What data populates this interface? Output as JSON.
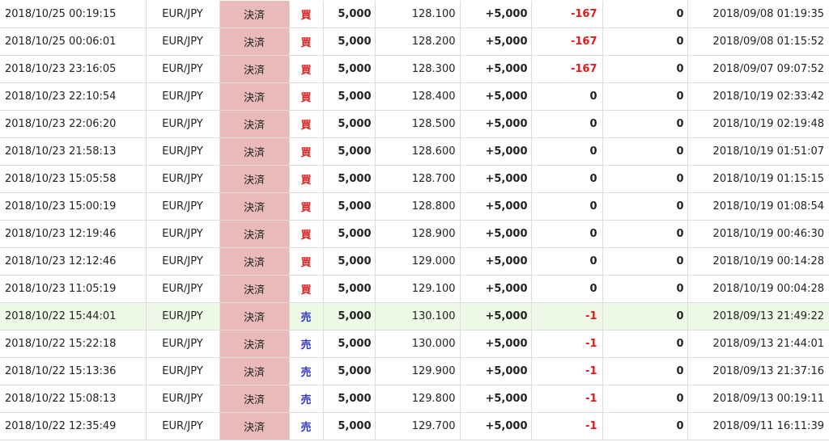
{
  "colors": {
    "buy": "#dd2020",
    "sell": "#2f35c8",
    "swap_positive": "#1a9a1a",
    "pl_negative": "#e01a1a",
    "type_bg": "#eab9b9",
    "highlight_row": "#eef9e7"
  },
  "rows": [
    {
      "time": "2018/10/25 00:19:15",
      "pair": "EUR/JPY",
      "type": "決済",
      "side": "買",
      "side_kind": "buy",
      "qty": "5,000",
      "rate": "128.100",
      "swap": "+5,000",
      "pl": "-167",
      "pl_kind": "neg",
      "fee": "0",
      "open_time": "2018/09/08 01:19:35",
      "highlight": false
    },
    {
      "time": "2018/10/25 00:06:01",
      "pair": "EUR/JPY",
      "type": "決済",
      "side": "買",
      "side_kind": "buy",
      "qty": "5,000",
      "rate": "128.200",
      "swap": "+5,000",
      "pl": "-167",
      "pl_kind": "neg",
      "fee": "0",
      "open_time": "2018/09/08 01:15:52",
      "highlight": false
    },
    {
      "time": "2018/10/23 23:16:05",
      "pair": "EUR/JPY",
      "type": "決済",
      "side": "買",
      "side_kind": "buy",
      "qty": "5,000",
      "rate": "128.300",
      "swap": "+5,000",
      "pl": "-167",
      "pl_kind": "neg",
      "fee": "0",
      "open_time": "2018/09/07 09:07:52",
      "highlight": false
    },
    {
      "time": "2018/10/23 22:10:54",
      "pair": "EUR/JPY",
      "type": "決済",
      "side": "買",
      "side_kind": "buy",
      "qty": "5,000",
      "rate": "128.400",
      "swap": "+5,000",
      "pl": "0",
      "pl_kind": "zero",
      "fee": "0",
      "open_time": "2018/10/19 02:33:42",
      "highlight": false
    },
    {
      "time": "2018/10/23 22:06:20",
      "pair": "EUR/JPY",
      "type": "決済",
      "side": "買",
      "side_kind": "buy",
      "qty": "5,000",
      "rate": "128.500",
      "swap": "+5,000",
      "pl": "0",
      "pl_kind": "zero",
      "fee": "0",
      "open_time": "2018/10/19 02:19:48",
      "highlight": false
    },
    {
      "time": "2018/10/23 21:58:13",
      "pair": "EUR/JPY",
      "type": "決済",
      "side": "買",
      "side_kind": "buy",
      "qty": "5,000",
      "rate": "128.600",
      "swap": "+5,000",
      "pl": "0",
      "pl_kind": "zero",
      "fee": "0",
      "open_time": "2018/10/19 01:51:07",
      "highlight": false
    },
    {
      "time": "2018/10/23 15:05:58",
      "pair": "EUR/JPY",
      "type": "決済",
      "side": "買",
      "side_kind": "buy",
      "qty": "5,000",
      "rate": "128.700",
      "swap": "+5,000",
      "pl": "0",
      "pl_kind": "zero",
      "fee": "0",
      "open_time": "2018/10/19 01:15:15",
      "highlight": false
    },
    {
      "time": "2018/10/23 15:00:19",
      "pair": "EUR/JPY",
      "type": "決済",
      "side": "買",
      "side_kind": "buy",
      "qty": "5,000",
      "rate": "128.800",
      "swap": "+5,000",
      "pl": "0",
      "pl_kind": "zero",
      "fee": "0",
      "open_time": "2018/10/19 01:08:54",
      "highlight": false
    },
    {
      "time": "2018/10/23 12:19:46",
      "pair": "EUR/JPY",
      "type": "決済",
      "side": "買",
      "side_kind": "buy",
      "qty": "5,000",
      "rate": "128.900",
      "swap": "+5,000",
      "pl": "0",
      "pl_kind": "zero",
      "fee": "0",
      "open_time": "2018/10/19 00:46:30",
      "highlight": false
    },
    {
      "time": "2018/10/23 12:12:46",
      "pair": "EUR/JPY",
      "type": "決済",
      "side": "買",
      "side_kind": "buy",
      "qty": "5,000",
      "rate": "129.000",
      "swap": "+5,000",
      "pl": "0",
      "pl_kind": "zero",
      "fee": "0",
      "open_time": "2018/10/19 00:14:28",
      "highlight": false
    },
    {
      "time": "2018/10/23 11:05:19",
      "pair": "EUR/JPY",
      "type": "決済",
      "side": "買",
      "side_kind": "buy",
      "qty": "5,000",
      "rate": "129.100",
      "swap": "+5,000",
      "pl": "0",
      "pl_kind": "zero",
      "fee": "0",
      "open_time": "2018/10/19 00:04:28",
      "highlight": false
    },
    {
      "time": "2018/10/22 15:44:01",
      "pair": "EUR/JPY",
      "type": "決済",
      "side": "売",
      "side_kind": "sell",
      "qty": "5,000",
      "rate": "130.100",
      "swap": "+5,000",
      "pl": "-1",
      "pl_kind": "neg",
      "fee": "0",
      "open_time": "2018/09/13 21:49:22",
      "highlight": true
    },
    {
      "time": "2018/10/22 15:22:18",
      "pair": "EUR/JPY",
      "type": "決済",
      "side": "売",
      "side_kind": "sell",
      "qty": "5,000",
      "rate": "130.000",
      "swap": "+5,000",
      "pl": "-1",
      "pl_kind": "neg",
      "fee": "0",
      "open_time": "2018/09/13 21:44:01",
      "highlight": false
    },
    {
      "time": "2018/10/22 15:13:36",
      "pair": "EUR/JPY",
      "type": "決済",
      "side": "売",
      "side_kind": "sell",
      "qty": "5,000",
      "rate": "129.900",
      "swap": "+5,000",
      "pl": "-1",
      "pl_kind": "neg",
      "fee": "0",
      "open_time": "2018/09/13 21:37:16",
      "highlight": false
    },
    {
      "time": "2018/10/22 15:08:13",
      "pair": "EUR/JPY",
      "type": "決済",
      "side": "売",
      "side_kind": "sell",
      "qty": "5,000",
      "rate": "129.800",
      "swap": "+5,000",
      "pl": "-1",
      "pl_kind": "neg",
      "fee": "0",
      "open_time": "2018/09/13 00:19:11",
      "highlight": false
    },
    {
      "time": "2018/10/22 12:35:49",
      "pair": "EUR/JPY",
      "type": "決済",
      "side": "売",
      "side_kind": "sell",
      "qty": "5,000",
      "rate": "129.700",
      "swap": "+5,000",
      "pl": "-1",
      "pl_kind": "neg",
      "fee": "0",
      "open_time": "2018/09/11 16:11:39",
      "highlight": false
    }
  ]
}
